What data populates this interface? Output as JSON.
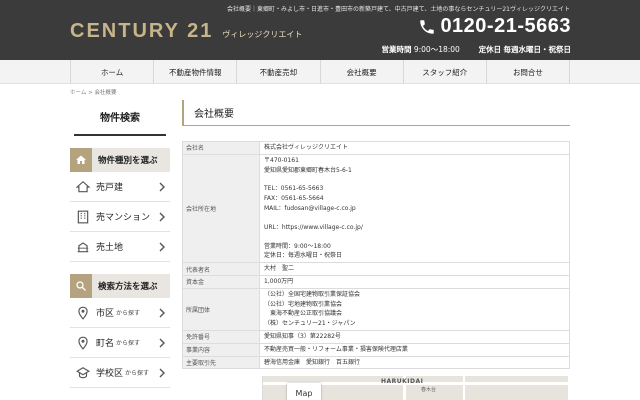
{
  "header": {
    "tagline": "会社概要｜東郷町・みよし市・日進市・豊田市の新築戸建て、中古戸建て、土地の事ならセンチュリー21ヴィレッジクリエイト",
    "logo_main": "CENTURY 21",
    "logo_sub": "ヴィレッジクリエイト",
    "phone_number": "0120-21-5663",
    "hours_label": "営業時間",
    "hours_value": "9:00～18:00",
    "closed_label": "定休日",
    "closed_value": "毎週水曜日・祝祭日"
  },
  "nav": {
    "items": [
      "ホーム",
      "不動産物件情報",
      "不動産売却",
      "会社概要",
      "スタッフ紹介",
      "お問合せ"
    ]
  },
  "breadcrumb": {
    "home": "ホーム",
    "sep": ">",
    "current": "会社概要"
  },
  "sidebar": {
    "title": "物件検索",
    "type_heading": "物件種別を選ぶ",
    "type_items": [
      "売戸建",
      "売マンション",
      "売土地"
    ],
    "method_heading": "検索方法を選ぶ",
    "method_items": [
      {
        "label": "市区",
        "suffix": "から探す"
      },
      {
        "label": "町名",
        "suffix": "から探す"
      },
      {
        "label": "学校区",
        "suffix": "から探す"
      }
    ]
  },
  "main": {
    "title": "会社概要",
    "rows": {
      "company_name": {
        "label": "会社名",
        "value": "株式会社ヴィレッジクリエイト"
      },
      "address": {
        "label": "会社所在地",
        "postal": "〒470-0161",
        "street": "愛知県愛知郡東郷町春木台5-6-1",
        "tel": "TEL：0561-65-5663",
        "fax": "FAX：0561-65-5664",
        "mail": "MAIL：fudosan@village-c.co.jp",
        "url": "URL：https://www.village-c.co.jp/",
        "hours": "営業時間：9:00～18:00",
        "closed": "定休日：毎週水曜日・祝祭日"
      },
      "representative": {
        "label": "代表者名",
        "value": "大村　聖二"
      },
      "capital": {
        "label": "資本金",
        "value": "1,000万円"
      },
      "associations": {
        "label": "所属団体",
        "values": [
          "（公社）全国宅建物取引業保証協会",
          "（公社）宅地建物取引業協会",
          "東海不動産公正取引協議会",
          "（株）センチュリー21・ジャパン"
        ]
      },
      "license": {
        "label": "免許番号",
        "value": "愛知県知事（3）第22282号"
      },
      "business": {
        "label": "事業内容",
        "value": "不動産売買一般・リフォーム事業・損害保険代理店業"
      },
      "bank": {
        "label": "主要取引先",
        "value": "碧海信用金庫　愛知銀行　百五銀行"
      }
    },
    "map": {
      "button": "Map",
      "label_en": "HARUKIDAI",
      "label_jp": "春木台"
    }
  },
  "colors": {
    "header_bg": "#3b3b3b",
    "accent_gold": "#b5a27f",
    "logo_gold": "#c8b48a"
  }
}
